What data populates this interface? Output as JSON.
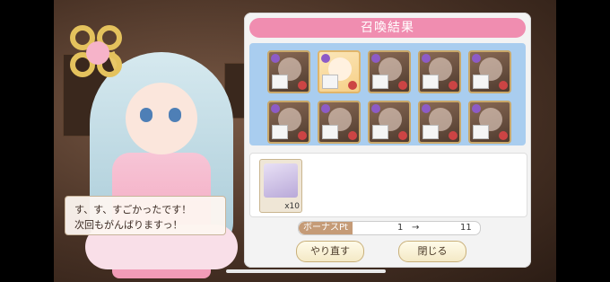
{
  "dialog": {
    "line1": "す、す、すごかったです！",
    "line2": "次回もがんばりますっ！"
  },
  "panel": {
    "title": "召喚結果",
    "cards": [
      {
        "name": "unit-1",
        "new": false
      },
      {
        "name": "unit-2",
        "new": true
      },
      {
        "name": "unit-3",
        "new": false
      },
      {
        "name": "unit-4",
        "new": false
      },
      {
        "name": "unit-5",
        "new": false
      },
      {
        "name": "unit-6",
        "new": false
      },
      {
        "name": "unit-7",
        "new": false
      },
      {
        "name": "unit-8",
        "new": false
      },
      {
        "name": "unit-9",
        "new": false
      },
      {
        "name": "unit-10",
        "new": false
      }
    ],
    "item": {
      "count": "x10"
    },
    "bonus": {
      "label": "ボーナスPt",
      "from": "1",
      "arrow": "→",
      "to": "11"
    },
    "buttons": {
      "retry": "やり直す",
      "close": "閉じる"
    }
  }
}
